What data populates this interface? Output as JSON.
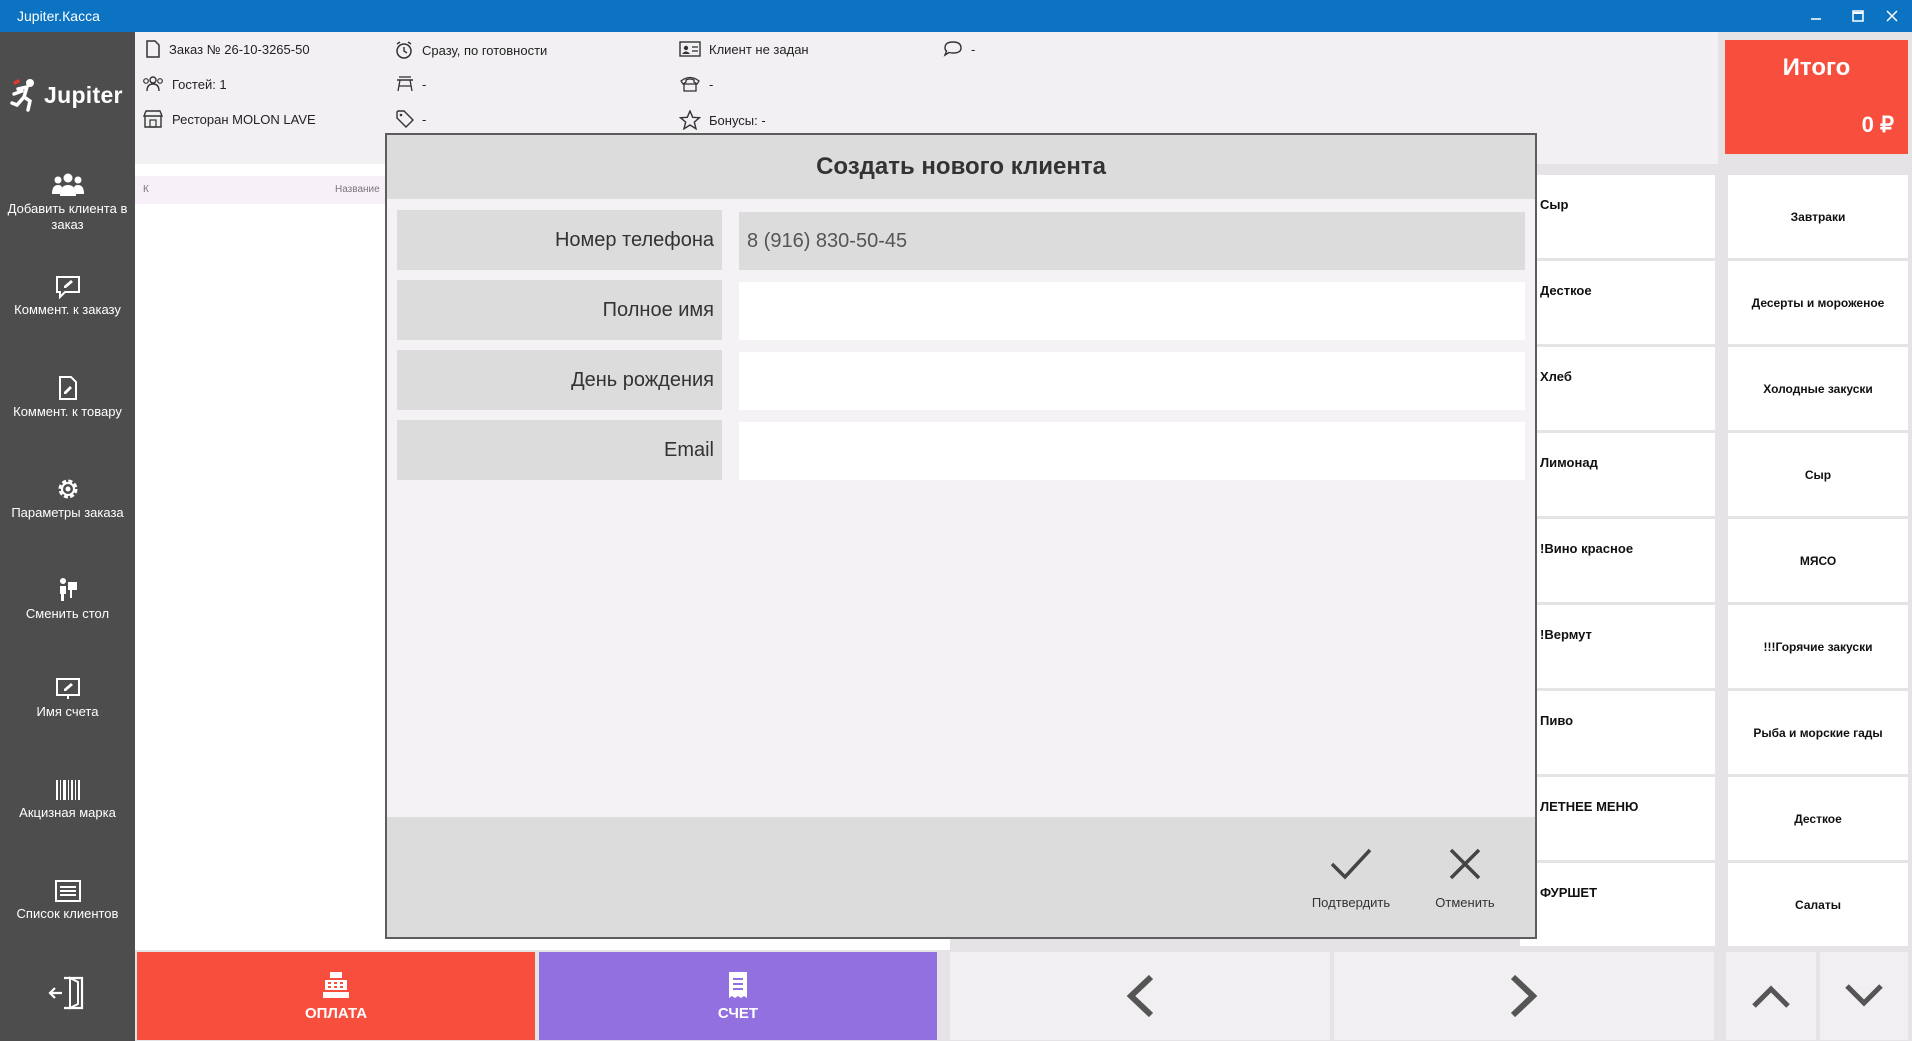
{
  "window": {
    "title": "Jupiter.Касса"
  },
  "logo": {
    "text": "Jupiter"
  },
  "sidebar": {
    "items": [
      {
        "label": "Добавить клиента в заказ",
        "icon": "users-icon"
      },
      {
        "label": "Коммент. к заказу",
        "icon": "comment-edit-icon"
      },
      {
        "label": "Коммент. к товару",
        "icon": "document-edit-icon"
      },
      {
        "label": "Параметры заказа",
        "icon": "gear-icon"
      },
      {
        "label": "Сменить стол",
        "icon": "move-table-icon"
      },
      {
        "label": "Имя счета",
        "icon": "rename-icon"
      },
      {
        "label": "Акцизная марка",
        "icon": "barcode-icon"
      },
      {
        "label": "Список клиентов",
        "icon": "list-icon"
      }
    ],
    "exit_icon": "exit-icon"
  },
  "order": {
    "number": "Заказ № 26-10-3265-50",
    "guests": "Гостей: 1",
    "restaurant": "Ресторан MOLON LAVE",
    "timing": "Сразу, по готовности",
    "table": "-",
    "discount": "-",
    "client": "Клиент не задан",
    "phone": "-",
    "bonuses": "Бонусы: -",
    "comment": "-"
  },
  "total": {
    "label": "Итого",
    "amount": "0 ₽"
  },
  "list": {
    "col_k": "К",
    "col_name": "Название"
  },
  "categories_left": [
    "Сыр",
    "Десткое",
    "Хлеб",
    "Лимонад",
    "!Вино красное",
    "!Вермут",
    "Пиво",
    "ЛЕТНЕЕ МЕНЮ",
    "ФУРШЕТ"
  ],
  "categories_right": [
    "Завтраки",
    "Десерты и мороженое",
    "Холодные закуски",
    "Сыр",
    "МЯСО",
    "!!!Горячие закуски",
    "Рыба и морские гады",
    "Десткое",
    "Салаты"
  ],
  "bottom": {
    "pay_label": "ОПЛАТА",
    "bill_label": "СЧЕТ"
  },
  "modal": {
    "title": "Создать нового клиента",
    "fields": [
      {
        "label": "Номер телефона",
        "value": "8 (916) 830-50-45"
      },
      {
        "label": "Полное имя",
        "value": ""
      },
      {
        "label": "День рождения",
        "value": ""
      },
      {
        "label": "Email",
        "value": ""
      }
    ],
    "confirm_label": "Подтвердить",
    "cancel_label": "Отменить"
  },
  "colors": {
    "titlebar": "#0c73c2",
    "sidebar": "#4d4d4d",
    "total": "#f74e3e",
    "pay": "#f74e3e",
    "bill": "#9370e0"
  }
}
